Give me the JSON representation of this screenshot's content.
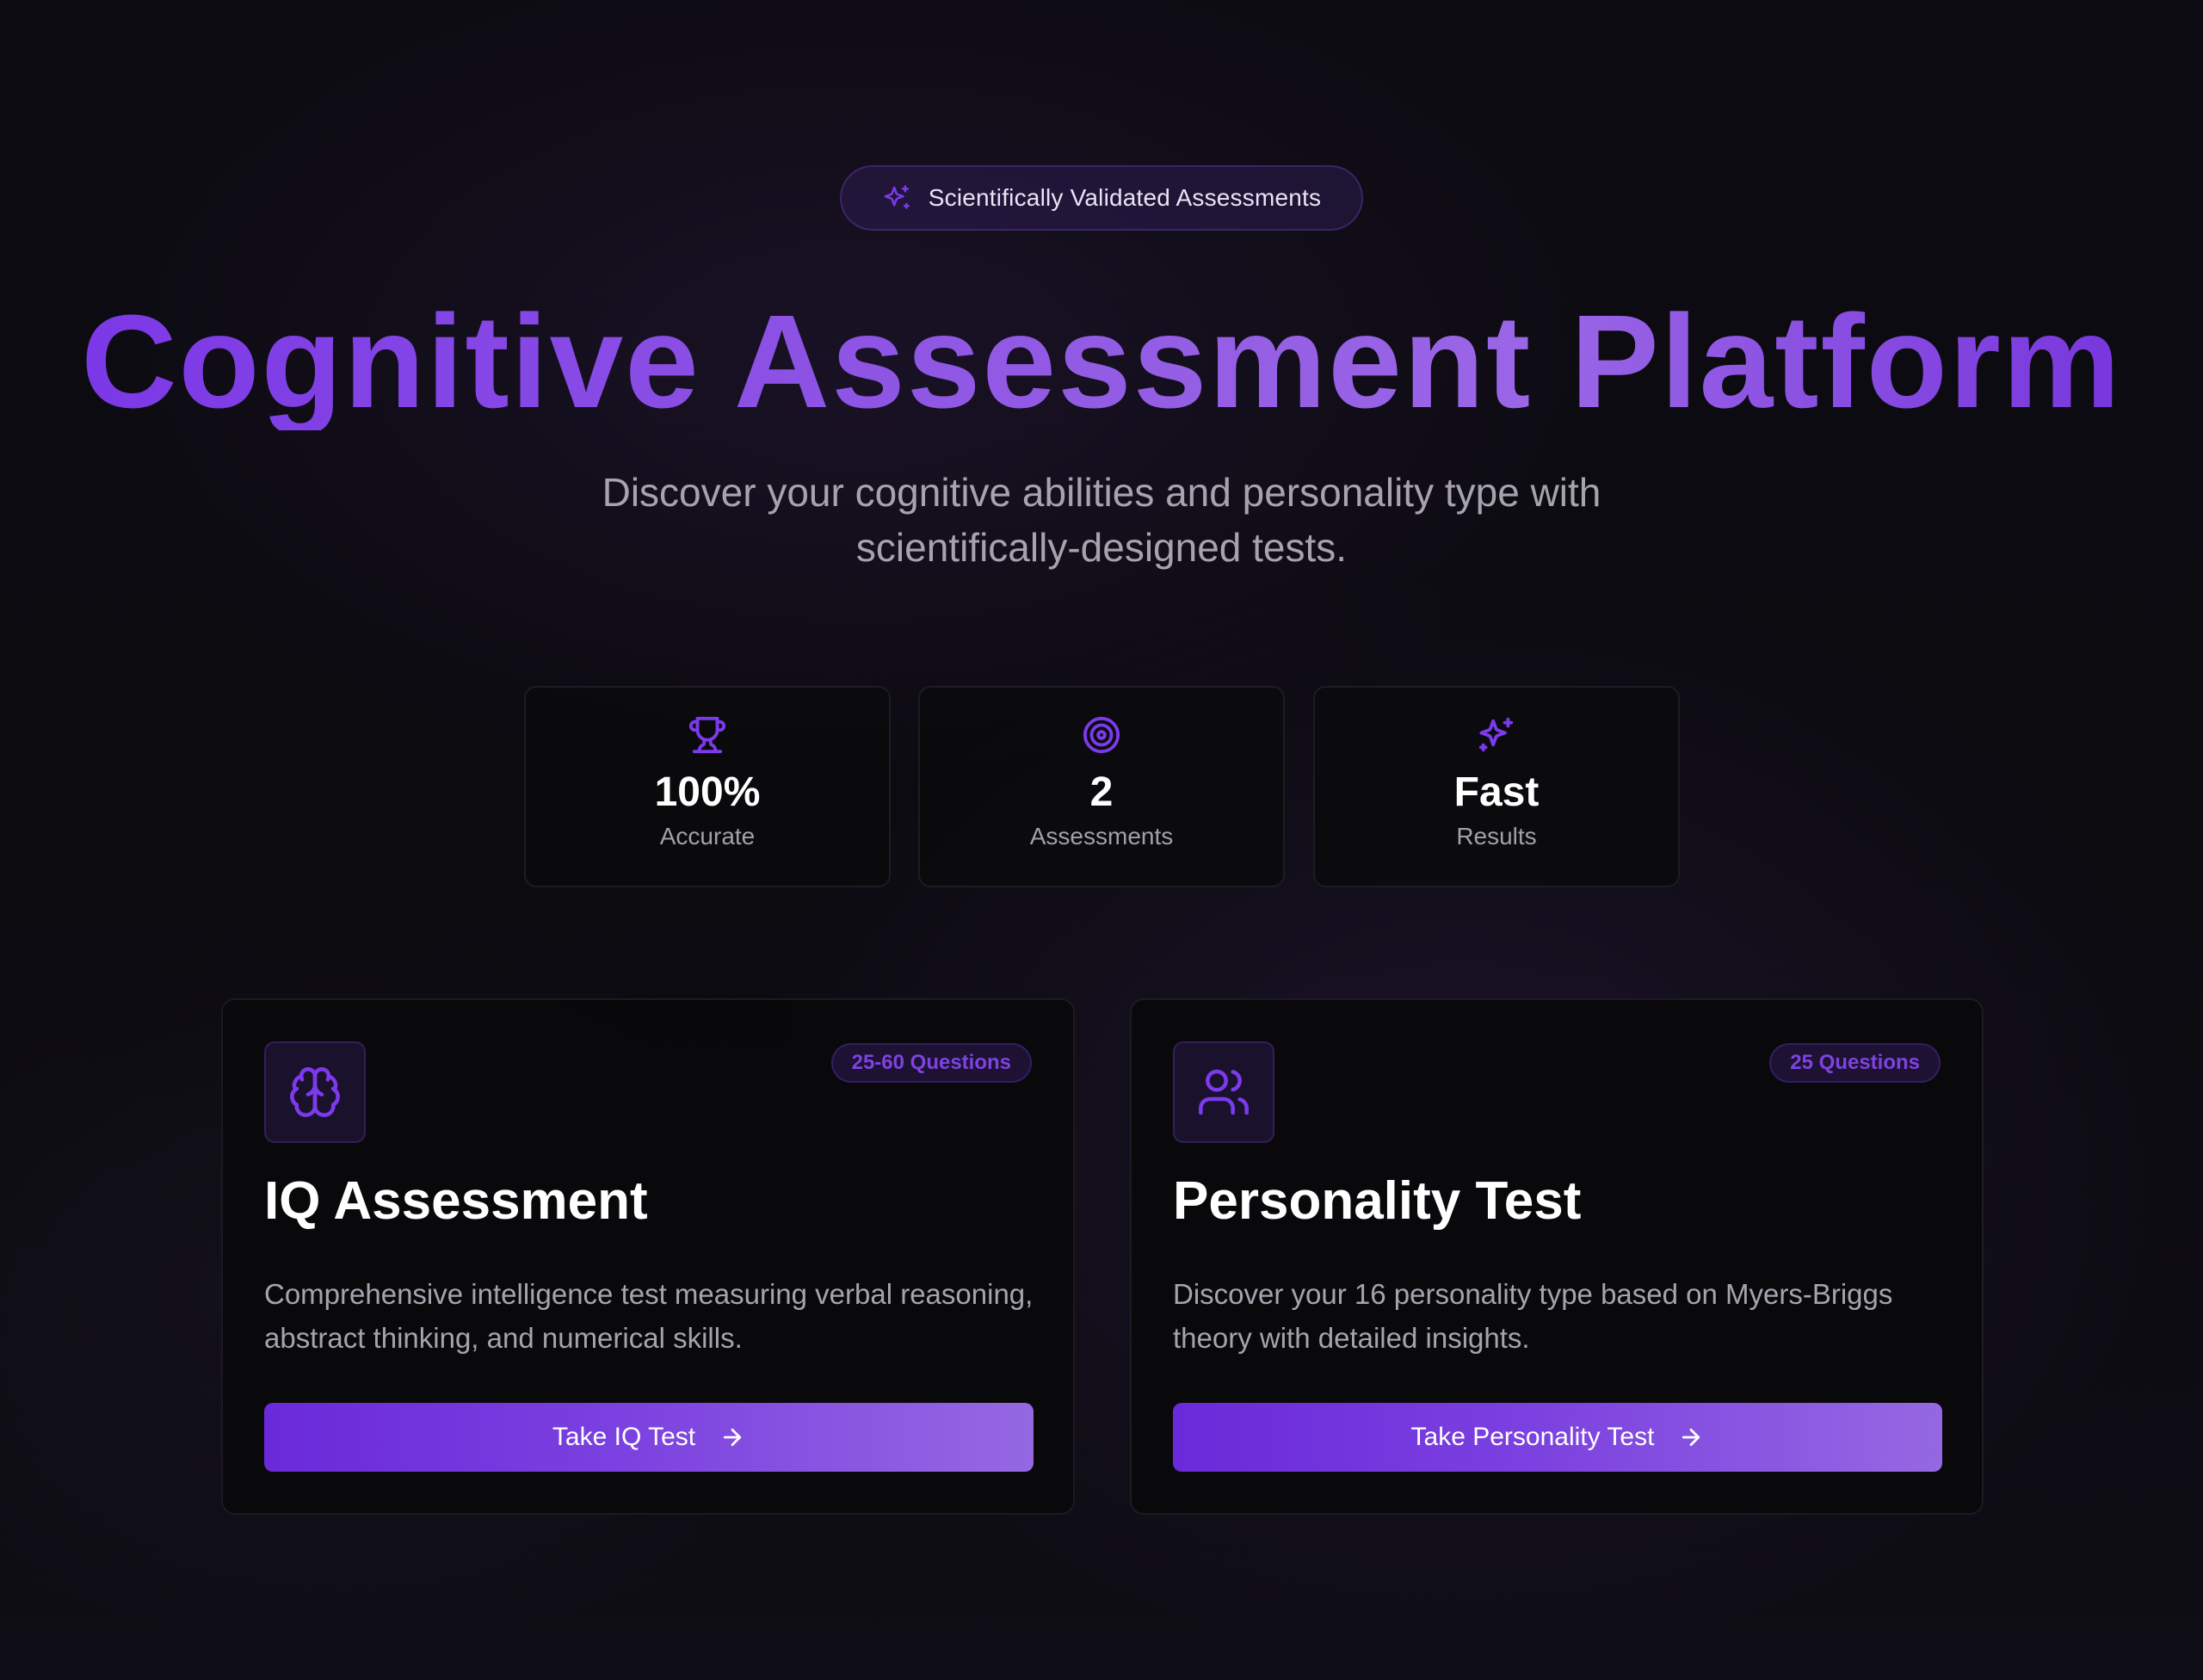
{
  "hero": {
    "badge": {
      "icon": "sparkles-icon",
      "text": "Scientifically Validated Assessments"
    },
    "title": "Cognitive Assessment Platform",
    "subtitle_line1": "Discover your cognitive abilities and personality type with",
    "subtitle_line2": "scientifically-designed tests."
  },
  "stats": [
    {
      "icon": "trophy-icon",
      "value": "100%",
      "label": "Accurate"
    },
    {
      "icon": "target-icon",
      "value": "2",
      "label": "Assessments"
    },
    {
      "icon": "sparkles-icon",
      "value": "Fast",
      "label": "Results"
    }
  ],
  "cards": [
    {
      "icon": "brain-icon",
      "badge": "25-60 Questions",
      "title": "IQ Assessment",
      "description": "Comprehensive intelligence test measuring verbal reasoning, abstract thinking, and numerical skills.",
      "button_label": "Take IQ Test",
      "button_icon": "arrow-right-icon"
    },
    {
      "icon": "users-icon",
      "badge": "25 Questions",
      "title": "Personality Test",
      "description": "Discover your 16 personality type based on Myers-Briggs theory with detailed insights.",
      "button_label": "Take Personality Test",
      "button_icon": "arrow-right-icon"
    }
  ],
  "colors": {
    "accent": "#7c3aed",
    "accent_light": "#9a66e6",
    "background": "#0c0b10",
    "text_muted": "#a7a3ae"
  }
}
